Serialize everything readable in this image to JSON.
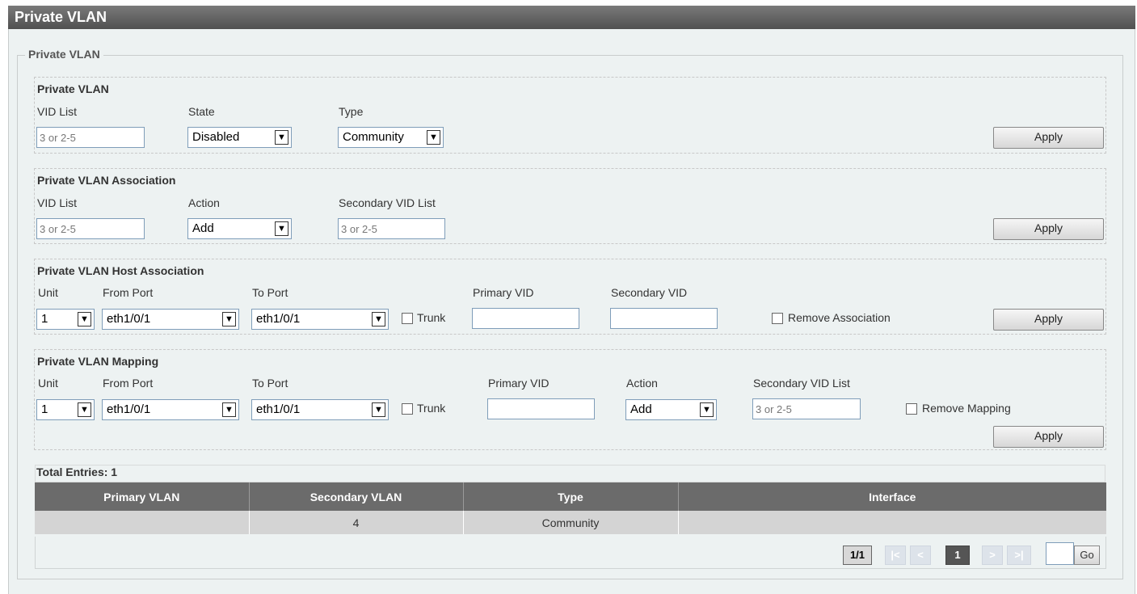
{
  "title": "Private VLAN",
  "fieldset_legend": "Private VLAN",
  "pvlan": {
    "title": "Private VLAN",
    "vid_list_label": "VID List",
    "vid_list_placeholder": "3 or 2-5",
    "state_label": "State",
    "state_value": "Disabled",
    "type_label": "Type",
    "type_value": "Community",
    "apply": "Apply"
  },
  "assoc": {
    "title": "Private VLAN Association",
    "vid_list_label": "VID List",
    "vid_list_placeholder": "3 or 2-5",
    "action_label": "Action",
    "action_value": "Add",
    "secondary_label": "Secondary VID List",
    "secondary_placeholder": "3 or 2-5",
    "apply": "Apply"
  },
  "host": {
    "title": "Private VLAN Host Association",
    "unit_label": "Unit",
    "unit_value": "1",
    "from_port_label": "From Port",
    "from_port_value": "eth1/0/1",
    "to_port_label": "To Port",
    "to_port_value": "eth1/0/1",
    "trunk_label": "Trunk",
    "primary_vid_label": "Primary VID",
    "secondary_vid_label": "Secondary VID",
    "remove_label": "Remove Association",
    "apply": "Apply"
  },
  "mapping": {
    "title": "Private VLAN Mapping",
    "unit_label": "Unit",
    "unit_value": "1",
    "from_port_label": "From Port",
    "from_port_value": "eth1/0/1",
    "to_port_label": "To Port",
    "to_port_value": "eth1/0/1",
    "trunk_label": "Trunk",
    "primary_vid_label": "Primary VID",
    "action_label": "Action",
    "action_value": "Add",
    "secondary_label": "Secondary VID List",
    "secondary_placeholder": "3 or 2-5",
    "remove_label": "Remove Mapping",
    "apply": "Apply"
  },
  "table": {
    "total": "Total Entries: 1",
    "headers": [
      "Primary VLAN",
      "Secondary VLAN",
      "Type",
      "Interface"
    ],
    "rows": [
      [
        "",
        "4",
        "Community",
        ""
      ]
    ]
  },
  "pager": {
    "count": "1/1",
    "first": "|<",
    "prev": "<",
    "current": "1",
    "next": ">",
    "last": ">|",
    "go": "Go"
  },
  "icons": {
    "dropdown": "chevron-down-icon"
  }
}
